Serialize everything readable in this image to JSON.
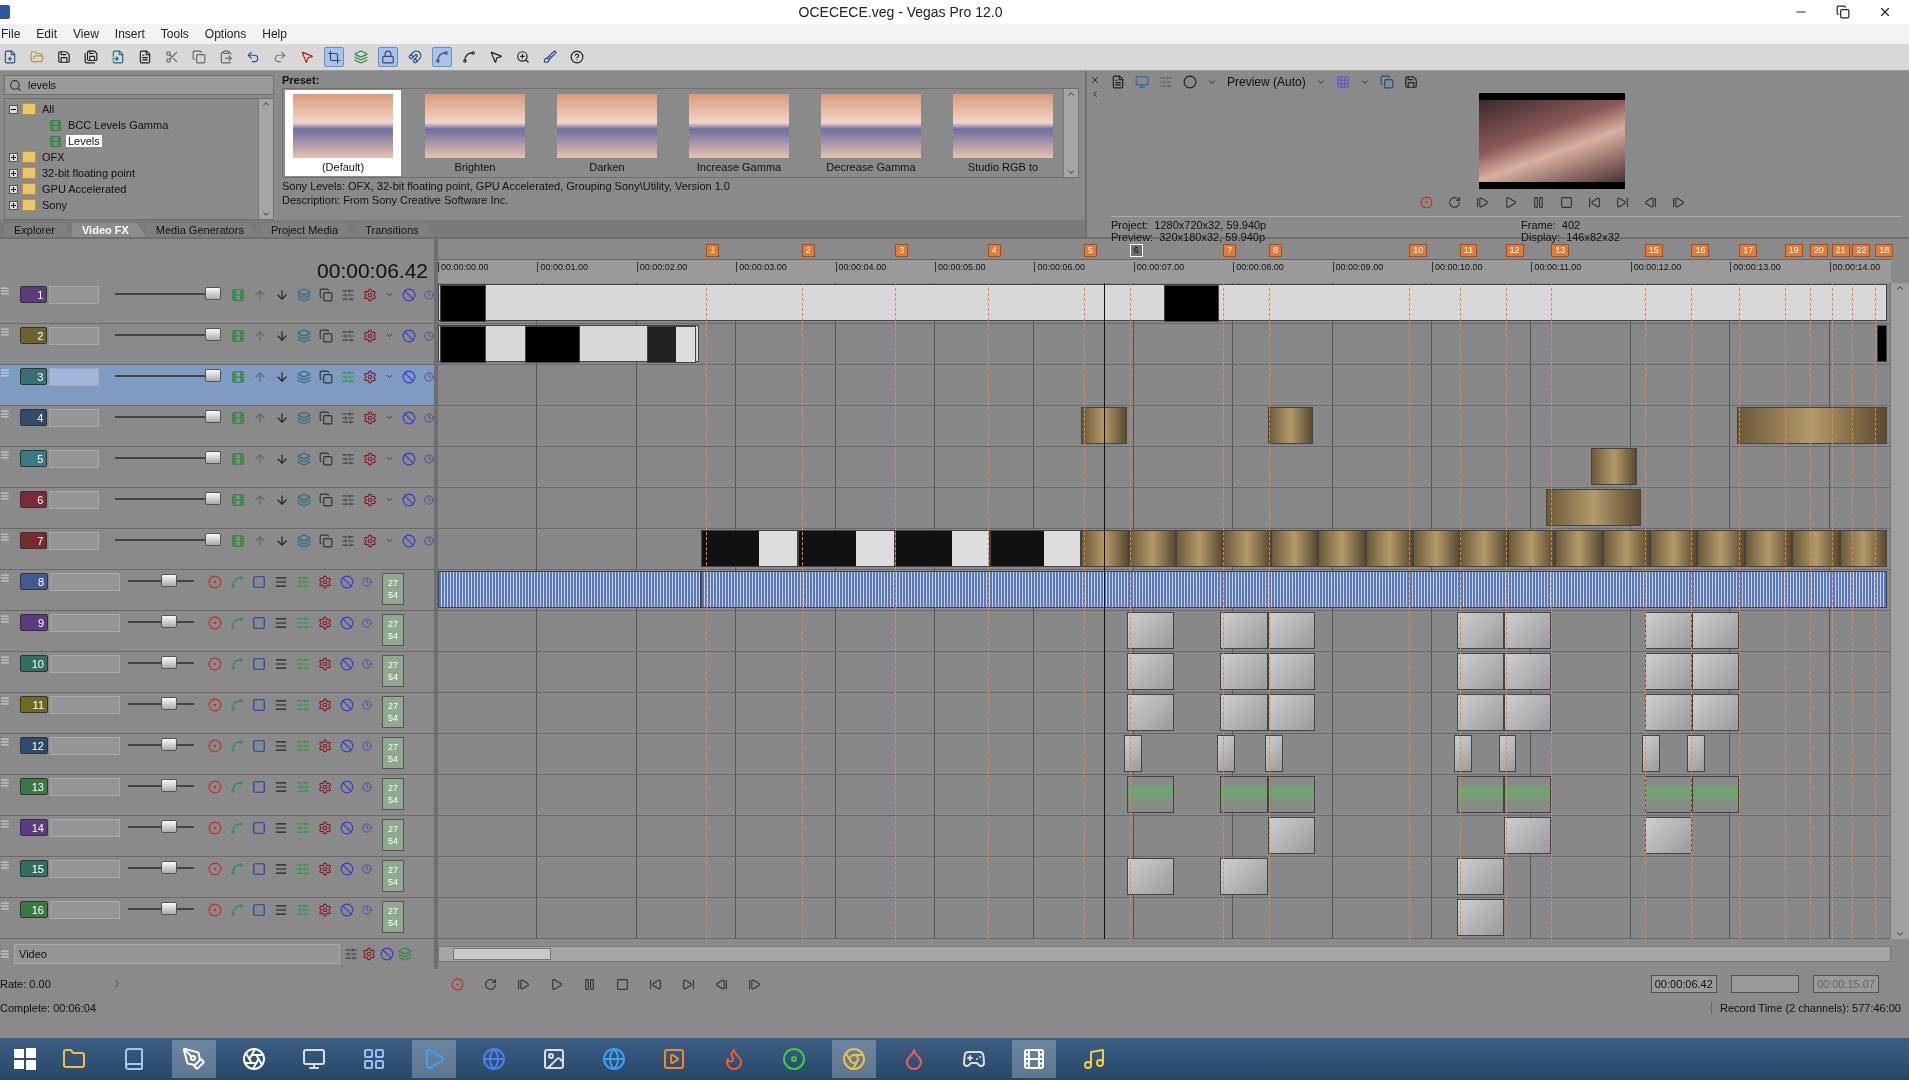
{
  "window": {
    "title": "OCECECE.veg - Vegas Pro 12.0"
  },
  "menu": [
    "File",
    "Edit",
    "View",
    "Insert",
    "Tools",
    "Options",
    "Help"
  ],
  "explorer": {
    "search": {
      "value": "levels"
    },
    "tree": [
      {
        "label": "All",
        "expanded": true,
        "selected": false,
        "children": [
          {
            "label": "BCC Levels Gamma",
            "selected": false
          },
          {
            "label": "Levels",
            "selected": true
          }
        ]
      },
      {
        "label": "OFX",
        "expanded": false,
        "selected": false
      },
      {
        "label": "32-bit floating point",
        "expanded": false,
        "selected": false
      },
      {
        "label": "GPU Accelerated",
        "expanded": false,
        "selected": false
      },
      {
        "label": "Sony",
        "expanded": false,
        "selected": false
      }
    ],
    "preset_label": "Preset:",
    "presets": [
      {
        "label": "(Default)",
        "selected": true
      },
      {
        "label": "Brighten",
        "selected": false
      },
      {
        "label": "Darken",
        "selected": false
      },
      {
        "label": "Increase Gamma",
        "selected": false
      },
      {
        "label": "Decrease Gamma",
        "selected": false
      },
      {
        "label": "Studio RGB to",
        "selected": false
      }
    ],
    "info_lines": [
      "Sony Levels: OFX, 32-bit floating point, GPU Accelerated, Grouping Sony\\Utility, Version 1.0",
      "Description: From Sony Creative Software Inc."
    ],
    "tabs": [
      {
        "label": "Explorer",
        "selected": false
      },
      {
        "label": "Video FX",
        "selected": true
      },
      {
        "label": "Media Generators",
        "selected": false
      },
      {
        "label": "Project Media",
        "selected": false
      },
      {
        "label": "Transitions",
        "selected": false
      }
    ]
  },
  "preview": {
    "mode": "Preview (Auto)",
    "info": [
      {
        "label": "Project:",
        "value": "1280x720x32, 59.940p"
      },
      {
        "label": "Frame:",
        "value": "402"
      },
      {
        "label": "Preview:",
        "value": "320x180x32, 59.940p"
      },
      {
        "label": "Display:",
        "value": "146x82x32"
      }
    ]
  },
  "timeline": {
    "timecode": "00:00:06.42",
    "markers": [
      {
        "label": "1",
        "selected": false
      },
      {
        "label": "2",
        "selected": false
      },
      {
        "label": "3",
        "selected": false
      },
      {
        "label": "4",
        "selected": false
      },
      {
        "label": "5",
        "selected": false
      },
      {
        "label": "6",
        "selected": true
      },
      {
        "label": "7",
        "selected": false
      },
      {
        "label": "8",
        "selected": false
      },
      {
        "label": "10",
        "selected": false
      },
      {
        "label": "11",
        "selected": false
      },
      {
        "label": "12",
        "selected": false
      },
      {
        "label": "13",
        "selected": false
      },
      {
        "label": "15",
        "selected": false
      },
      {
        "label": "16",
        "selected": false
      },
      {
        "label": "17",
        "selected": false
      },
      {
        "label": "19",
        "selected": false
      },
      {
        "label": "20",
        "selected": false
      },
      {
        "label": "21",
        "selected": false
      },
      {
        "label": "22",
        "selected": false
      },
      {
        "label": "18",
        "selected": false
      }
    ],
    "ruler": [
      "00:00:00.00",
      "00:00:01.00",
      "00:00:02.00",
      "00:00:03.00",
      "00:00:04.00",
      "00:00:05.00",
      "00:00:06.00",
      "00:00:07.00",
      "00:00:08.00",
      "00:00:09.00",
      "00:00:10.00",
      "00:00:11.00",
      "00:00:12.00",
      "00:00:13.00",
      "00:00:14.00"
    ],
    "tracks": [
      {
        "number": "1",
        "kind": "video",
        "color": "#5b3b7c",
        "selected": false,
        "level": 1
      },
      {
        "number": "2",
        "kind": "video",
        "color": "#6d6230",
        "selected": false,
        "level": 1
      },
      {
        "number": "3",
        "kind": "video",
        "color": "#3b7072",
        "selected": true,
        "level": 1
      },
      {
        "number": "4",
        "kind": "video",
        "color": "#2f4a6b",
        "selected": false,
        "level": 1
      },
      {
        "number": "5",
        "kind": "video",
        "color": "#3a7a82",
        "selected": false,
        "level": 1
      },
      {
        "number": "6",
        "kind": "video",
        "color": "#7b2b36",
        "selected": false,
        "level": 1
      },
      {
        "number": "7",
        "kind": "video",
        "color": "#7a2a31",
        "selected": false,
        "level": 1
      },
      {
        "number": "8",
        "kind": "audio",
        "color": "#3f5b92",
        "selected": false,
        "level": 0.65,
        "meter": [
          "27",
          "54"
        ]
      },
      {
        "number": "9",
        "kind": "audio",
        "color": "#5b3b82",
        "selected": false,
        "level": 0.65,
        "meter": [
          "27",
          "54"
        ]
      },
      {
        "number": "10",
        "kind": "audio",
        "color": "#2e7062",
        "selected": false,
        "level": 0.65,
        "meter": [
          "27",
          "54"
        ]
      },
      {
        "number": "11",
        "kind": "audio",
        "color": "#6e6a22",
        "selected": false,
        "level": 0.65,
        "meter": [
          "27",
          "54"
        ]
      },
      {
        "number": "12",
        "kind": "audio",
        "color": "#2f4a6b",
        "selected": false,
        "level": 0.65,
        "meter": [
          "27",
          "54"
        ]
      },
      {
        "number": "13",
        "kind": "audio",
        "color": "#3a7a42",
        "selected": false,
        "level": 0.65,
        "meter": [
          "27",
          "54"
        ]
      },
      {
        "number": "14",
        "kind": "audio",
        "color": "#5b3b82",
        "selected": false,
        "level": 0.65,
        "meter": [
          "27",
          "54"
        ]
      },
      {
        "number": "15",
        "kind": "audio",
        "color": "#2e7062",
        "selected": false,
        "level": 0.65,
        "meter": [
          "27",
          "54"
        ]
      },
      {
        "number": "16",
        "kind": "audio",
        "color": "#3a7a42",
        "selected": false,
        "level": 0.65,
        "meter": [
          "27",
          "54"
        ]
      }
    ],
    "bus": {
      "name": "Video"
    },
    "rate": "Rate: 0.00",
    "cursor_time": "00:00:06.42",
    "length_time": "00:00:15.07"
  },
  "status": {
    "left": "Complete: 00:06:04",
    "right": "Record Time (2 channels): 577:46:00"
  }
}
